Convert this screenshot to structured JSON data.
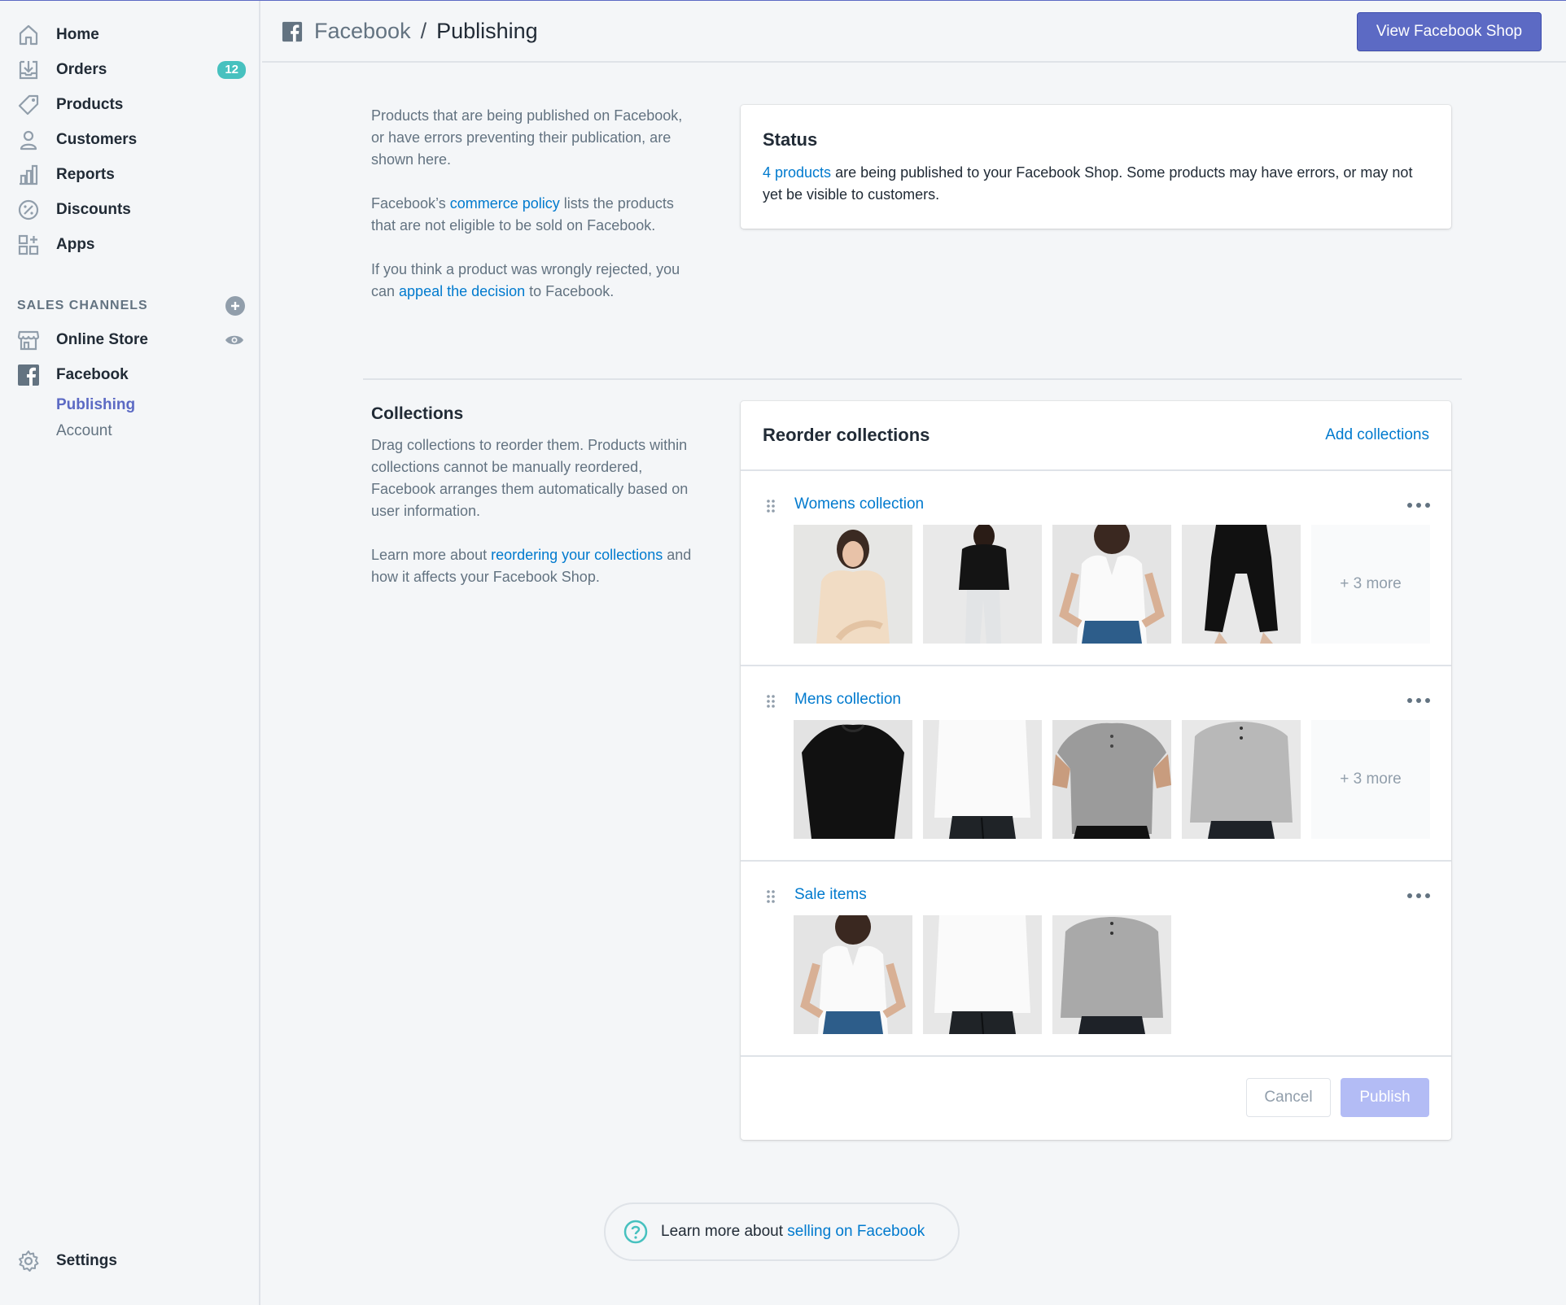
{
  "nav": [
    {
      "label": "Home",
      "icon": "home-icon"
    },
    {
      "label": "Orders",
      "icon": "orders-icon",
      "badge": "12"
    },
    {
      "label": "Products",
      "icon": "tag-icon"
    },
    {
      "label": "Customers",
      "icon": "customer-icon"
    },
    {
      "label": "Reports",
      "icon": "reports-icon"
    },
    {
      "label": "Discounts",
      "icon": "discount-icon"
    },
    {
      "label": "Apps",
      "icon": "apps-icon"
    }
  ],
  "sales_channels": {
    "heading": "SALES CHANNELS",
    "online_store": "Online Store",
    "facebook": "Facebook",
    "publishing": "Publishing",
    "account": "Account"
  },
  "settings_label": "Settings",
  "header": {
    "crumb_parent": "Facebook",
    "crumb_sep": "/",
    "crumb_current": "Publishing",
    "view_shop_button": "View Facebook Shop"
  },
  "intro": {
    "p1": "Products that are being published on Facebook, or have errors preventing their publication, are shown here.",
    "p2_a": "Facebook’s ",
    "p2_link": "commerce policy",
    "p2_b": " lists the products that are not eligible to be sold on Facebook.",
    "p3_a": "If you think a product was wrongly rejected, you can ",
    "p3_link": "appeal the decision",
    "p3_b": " to Facebook."
  },
  "status": {
    "title": "Status",
    "link": "4 products",
    "text": " are being published to your Facebook Shop. Some products may have errors, or may not yet be visible to customers."
  },
  "collections_info": {
    "title": "Collections",
    "p1": "Drag collections to reorder them. Products within collections cannot be manually reordered, Facebook arranges them automatically based on user information.",
    "p2_a": "Learn more about ",
    "p2_link": "reordering your collections",
    "p2_b": " and how it affects your Facebook Shop."
  },
  "reorder": {
    "title": "Reorder collections",
    "add_link": "Add collections",
    "collections": [
      {
        "name": "Womens collection",
        "more": "+ 3 more"
      },
      {
        "name": "Mens collection",
        "more": "+ 3 more"
      },
      {
        "name": "Sale items"
      }
    ],
    "cancel": "Cancel",
    "publish": "Publish"
  },
  "help": {
    "text": "Learn more about ",
    "link": "selling on Facebook"
  },
  "colors": {
    "accent": "#5c6ac4",
    "link": "#007ace",
    "badge": "#47c1bf"
  }
}
